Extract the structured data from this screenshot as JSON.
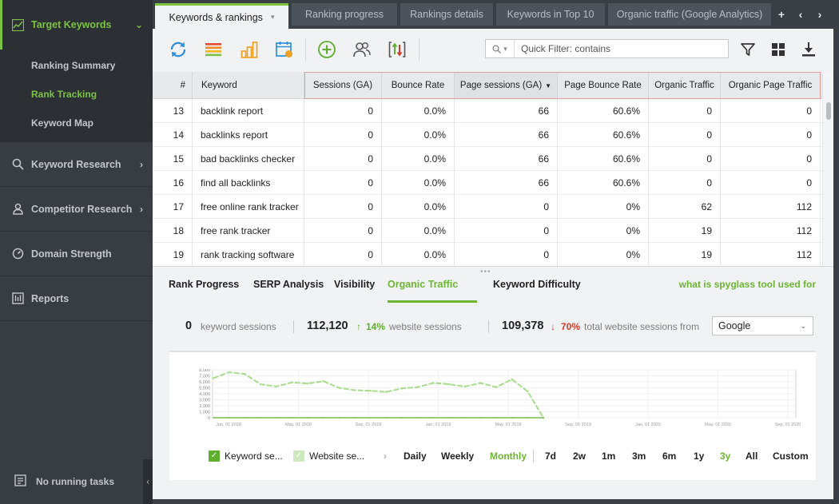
{
  "sidebar": {
    "sections": [
      {
        "label": "Target Keywords",
        "icon": "chart-line-icon"
      },
      {
        "label": "Keyword Research",
        "icon": "search-icon"
      },
      {
        "label": "Competitor Research",
        "icon": "user-icon"
      },
      {
        "label": "Domain Strength",
        "icon": "gauge-icon"
      },
      {
        "label": "Reports",
        "icon": "report-icon"
      }
    ],
    "sub_items": [
      "Ranking Summary",
      "Rank Tracking",
      "Keyword Map"
    ],
    "footer": "No running tasks"
  },
  "tabs": [
    "Keywords & rankings",
    "Ranking progress",
    "Rankings details",
    "Keywords in Top 10",
    "Organic traffic (Google Analytics)"
  ],
  "toolbar": {
    "quick_filter_placeholder": "Quick Filter: contains",
    "icons": [
      "refresh-icon",
      "list-icon",
      "bar-chart-icon",
      "calendar-icon",
      "add-icon",
      "users-icon",
      "import-export-icon",
      "filter-icon",
      "grid-icon",
      "download-icon"
    ]
  },
  "table": {
    "columns": [
      "#",
      "Keyword",
      "Sessions (GA)",
      "Bounce Rate",
      "Page sessions (GA)",
      "Page Bounce Rate",
      "Organic Traffic",
      "Organic Page Traffic"
    ],
    "rows": [
      [
        "13",
        "backlink report",
        "0",
        "0.0%",
        "66",
        "60.6%",
        "0",
        "0"
      ],
      [
        "14",
        "backlinks report",
        "0",
        "0.0%",
        "66",
        "60.6%",
        "0",
        "0"
      ],
      [
        "15",
        "bad backlinks checker",
        "0",
        "0.0%",
        "66",
        "60.6%",
        "0",
        "0"
      ],
      [
        "16",
        "find all backlinks",
        "0",
        "0.0%",
        "66",
        "60.6%",
        "0",
        "0"
      ],
      [
        "17",
        "free online rank tracker",
        "0",
        "0.0%",
        "0",
        "0%",
        "62",
        "112"
      ],
      [
        "18",
        "free rank tracker",
        "0",
        "0.0%",
        "0",
        "0%",
        "19",
        "112"
      ],
      [
        "19",
        "rank tracking software",
        "0",
        "0.0%",
        "0",
        "0%",
        "19",
        "112"
      ]
    ]
  },
  "lower_tabs": [
    "Rank Progress",
    "SERP Analysis",
    "Visibility",
    "Organic Traffic (GA)",
    "Keyword Difficulty"
  ],
  "spyglass_link": "what is spyglass tool used for",
  "stats": {
    "keyword_sessions": "0",
    "keyword_sessions_label": "keyword sessions",
    "website_sessions": "112,120",
    "website_change": "14%",
    "website_sessions_label": "website sessions",
    "total_sessions": "109,378",
    "total_change": "70%",
    "total_label": "total website sessions from",
    "source": "Google"
  },
  "chart_data": {
    "type": "line",
    "y_ticks": [
      "8,000",
      "7,000",
      "6,000",
      "5,000",
      "4,000",
      "3,000",
      "2,000",
      "1,000",
      "0"
    ],
    "x_ticks": [
      "Jan, 01 2018",
      "May, 01 2018",
      "Sep, 01 2018",
      "Jan, 01 2019",
      "May, 01 2019",
      "Sep, 01 2019",
      "Jan, 01 2020",
      "May, 01 2020",
      "Sep, 01 2020"
    ],
    "ylim": [
      0,
      8000
    ],
    "series": [
      {
        "name": "Website sessions",
        "color": "#a9dc8c",
        "values": [
          6600,
          7600,
          7300,
          5600,
          5200,
          5900,
          5700,
          6100,
          5000,
          4600,
          4500,
          4300,
          4900,
          5100,
          5800,
          5600,
          5200,
          5800,
          5100,
          6400,
          4400,
          0
        ]
      },
      {
        "name": "Keyword sessions",
        "color": "#5fae2e",
        "values": [
          0,
          0,
          0,
          0,
          0,
          0,
          0,
          0,
          0,
          0,
          0,
          0,
          0,
          0,
          0,
          0,
          0,
          0,
          0,
          0,
          0,
          0
        ]
      }
    ]
  },
  "legend": {
    "keyword": "Keyword se...",
    "website": "Website se..."
  },
  "granularity": [
    "Daily",
    "Weekly",
    "Monthly"
  ],
  "ranges": [
    "7d",
    "2w",
    "1m",
    "3m",
    "6m",
    "1y",
    "3y",
    "All",
    "Custom"
  ],
  "colors": {
    "accent": "#6cb532",
    "up": "#5fae2e",
    "down": "#d23b2b"
  }
}
